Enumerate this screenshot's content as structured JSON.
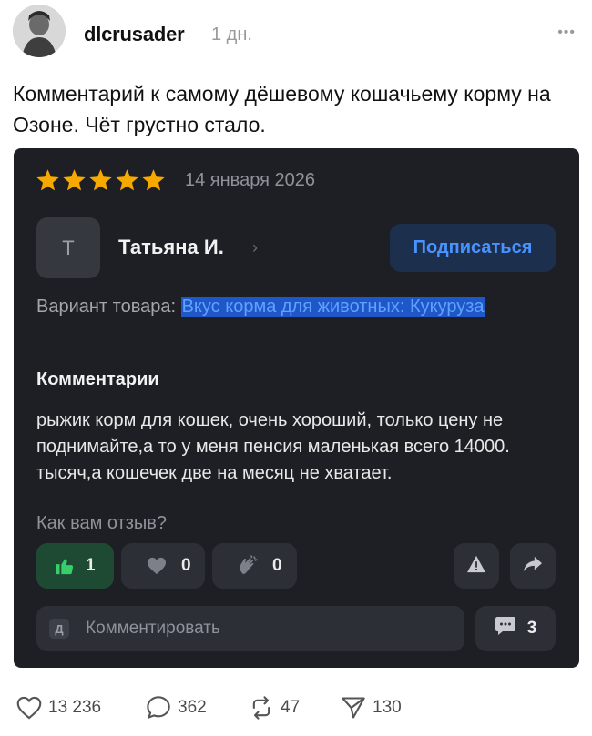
{
  "post": {
    "username": "dlcrusader",
    "time": "1 дн.",
    "more_icon": "more-dots-icon",
    "text": "Комментарий к самому дёшевому кошачьему корму на Озоне. Чёт грустно стало."
  },
  "review": {
    "rating": 5,
    "rating_max": 5,
    "star_color": "#f8a900",
    "date": "14 января 2026",
    "author_initial": "Т",
    "author_name": "Татьяна И.",
    "author_chevron": "›",
    "subscribe_label": "Подписаться",
    "variant_label": "Вариант товара:",
    "variant_value": "Вкус корма для животных: Кукуруза",
    "comments_title": "Комментарии",
    "comment_text": "рыжик корм для кошек, очень хороший, только цену не поднимайте,а то у меня пенсия маленькая всего 14000. тысяч,а кошечек две на месяц не хватает.",
    "question": "Как вам отзыв?",
    "reactions": {
      "like": "1",
      "heart": "0",
      "clap": "0"
    },
    "comment_avatar_initial": "Д",
    "comment_placeholder": "Комментировать",
    "comments_count": "3"
  },
  "actions": {
    "likes": "13 236",
    "replies": "362",
    "reposts": "47",
    "shares": "130"
  },
  "colors": {
    "card_bg": "#1d1f24",
    "accent_blue": "#4a93ff",
    "like_green": "#1e4a34"
  }
}
